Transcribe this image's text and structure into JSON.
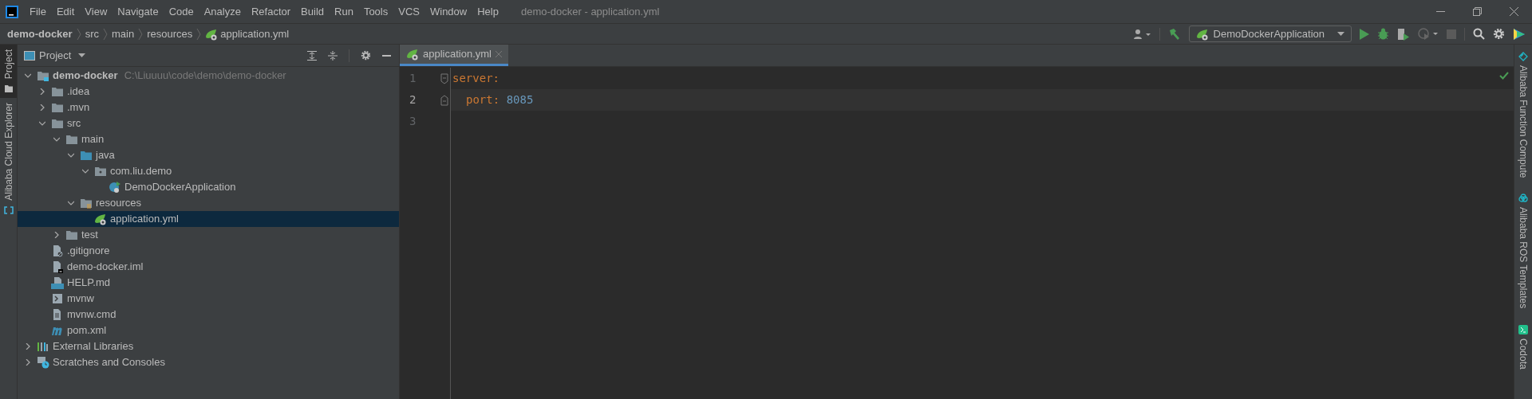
{
  "window": {
    "title": "demo-docker - application.yml"
  },
  "menu": [
    "File",
    "Edit",
    "View",
    "Navigate",
    "Code",
    "Analyze",
    "Refactor",
    "Build",
    "Run",
    "Tools",
    "VCS",
    "Window",
    "Help"
  ],
  "breadcrumbs": [
    {
      "label": "demo-docker",
      "kind": "project"
    },
    {
      "label": "src",
      "kind": "folder"
    },
    {
      "label": "main",
      "kind": "folder"
    },
    {
      "label": "resources",
      "kind": "folder"
    },
    {
      "label": "application.yml",
      "kind": "yaml"
    }
  ],
  "run_config": {
    "label": "DemoDockerApplication"
  },
  "left_strip": [
    "Project",
    "Alibaba Cloud Explorer"
  ],
  "project_panel": {
    "title": "Project"
  },
  "tree": [
    {
      "label": "demo-docker",
      "path": "C:\\Liuuuu\\code\\demo\\demo-docker",
      "kind": "module",
      "expanded": true,
      "selected": false,
      "children": [
        {
          "label": ".idea",
          "kind": "folder",
          "expanded": false,
          "selected": false
        },
        {
          "label": ".mvn",
          "kind": "folder",
          "expanded": false,
          "selected": false
        },
        {
          "label": "src",
          "kind": "folder",
          "expanded": true,
          "selected": false,
          "children": [
            {
              "label": "main",
              "kind": "folder",
              "expanded": true,
              "selected": false,
              "children": [
                {
                  "label": "java",
                  "kind": "source",
                  "expanded": true,
                  "selected": false,
                  "children": [
                    {
                      "label": "com.liu.demo",
                      "kind": "package",
                      "expanded": true,
                      "selected": false,
                      "children": [
                        {
                          "label": "DemoDockerApplication",
                          "kind": "class",
                          "selected": false
                        }
                      ]
                    }
                  ]
                },
                {
                  "label": "resources",
                  "kind": "resources",
                  "expanded": true,
                  "selected": false,
                  "children": [
                    {
                      "label": "application.yml",
                      "kind": "yaml",
                      "selected": true
                    }
                  ]
                }
              ]
            },
            {
              "label": "test",
              "kind": "folder",
              "expanded": false,
              "selected": false
            }
          ]
        },
        {
          "label": ".gitignore",
          "kind": "gitignore",
          "selected": false
        },
        {
          "label": "demo-docker.iml",
          "kind": "iml",
          "selected": false
        },
        {
          "label": "HELP.md",
          "kind": "markdown",
          "selected": false
        },
        {
          "label": "mvnw",
          "kind": "script",
          "selected": false
        },
        {
          "label": "mvnw.cmd",
          "kind": "text",
          "selected": false
        },
        {
          "label": "pom.xml",
          "kind": "maven",
          "selected": false
        }
      ]
    },
    {
      "label": "External Libraries",
      "kind": "libraries",
      "expanded": false,
      "selected": false
    },
    {
      "label": "Scratches and Consoles",
      "kind": "scratches",
      "expanded": false,
      "selected": false
    }
  ],
  "editor": {
    "tabs": [
      {
        "label": "application.yml",
        "selected": true
      }
    ],
    "lines": [
      {
        "number": "1",
        "current": false,
        "foldable": true,
        "tokens": [
          {
            "text": "server",
            "kind": "key"
          },
          {
            "text": ":",
            "kind": "punct"
          }
        ],
        "children": [
          {
            "number": "2",
            "current": true,
            "foldable": true,
            "tokens": [
              {
                "text": "port",
                "kind": "key"
              },
              {
                "text": ":",
                "kind": "punct"
              },
              {
                "text": "8085",
                "kind": "number"
              }
            ]
          }
        ]
      },
      {
        "number": "3",
        "current": false,
        "foldable": false
      }
    ]
  },
  "right_strip": [
    {
      "label": "Alibaba Function Compute",
      "kind": "function"
    },
    {
      "label": "Alibaba ROS Templates",
      "kind": "ros"
    },
    {
      "label": "Codota",
      "kind": "codota"
    }
  ]
}
